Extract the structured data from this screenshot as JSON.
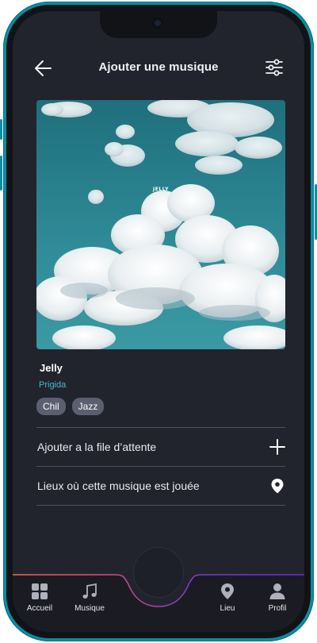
{
  "header": {
    "title": "Ajouter une musique"
  },
  "cover": {
    "label": "JELLY"
  },
  "track": {
    "title": "Jelly",
    "artist": "Prigida",
    "tags": [
      "Chil",
      "Jazz"
    ]
  },
  "actions": {
    "queue_label": "Ajouter a la file d’attente",
    "places_label": "Lieux où cette musique est jouée"
  },
  "nav": {
    "home": "Accueil",
    "music": "Musique",
    "place": "Lieu",
    "profile": "Profil"
  },
  "colors": {
    "background": "#22242d",
    "accent": "#46b9cf",
    "frame": "#0c8da2",
    "tag": "#5b5f70"
  },
  "icons": [
    "arrow-left-icon",
    "sliders-icon",
    "plus-icon",
    "map-pin-icon",
    "grid-icon",
    "music-note-icon",
    "user-icon",
    "waveform-icon"
  ]
}
